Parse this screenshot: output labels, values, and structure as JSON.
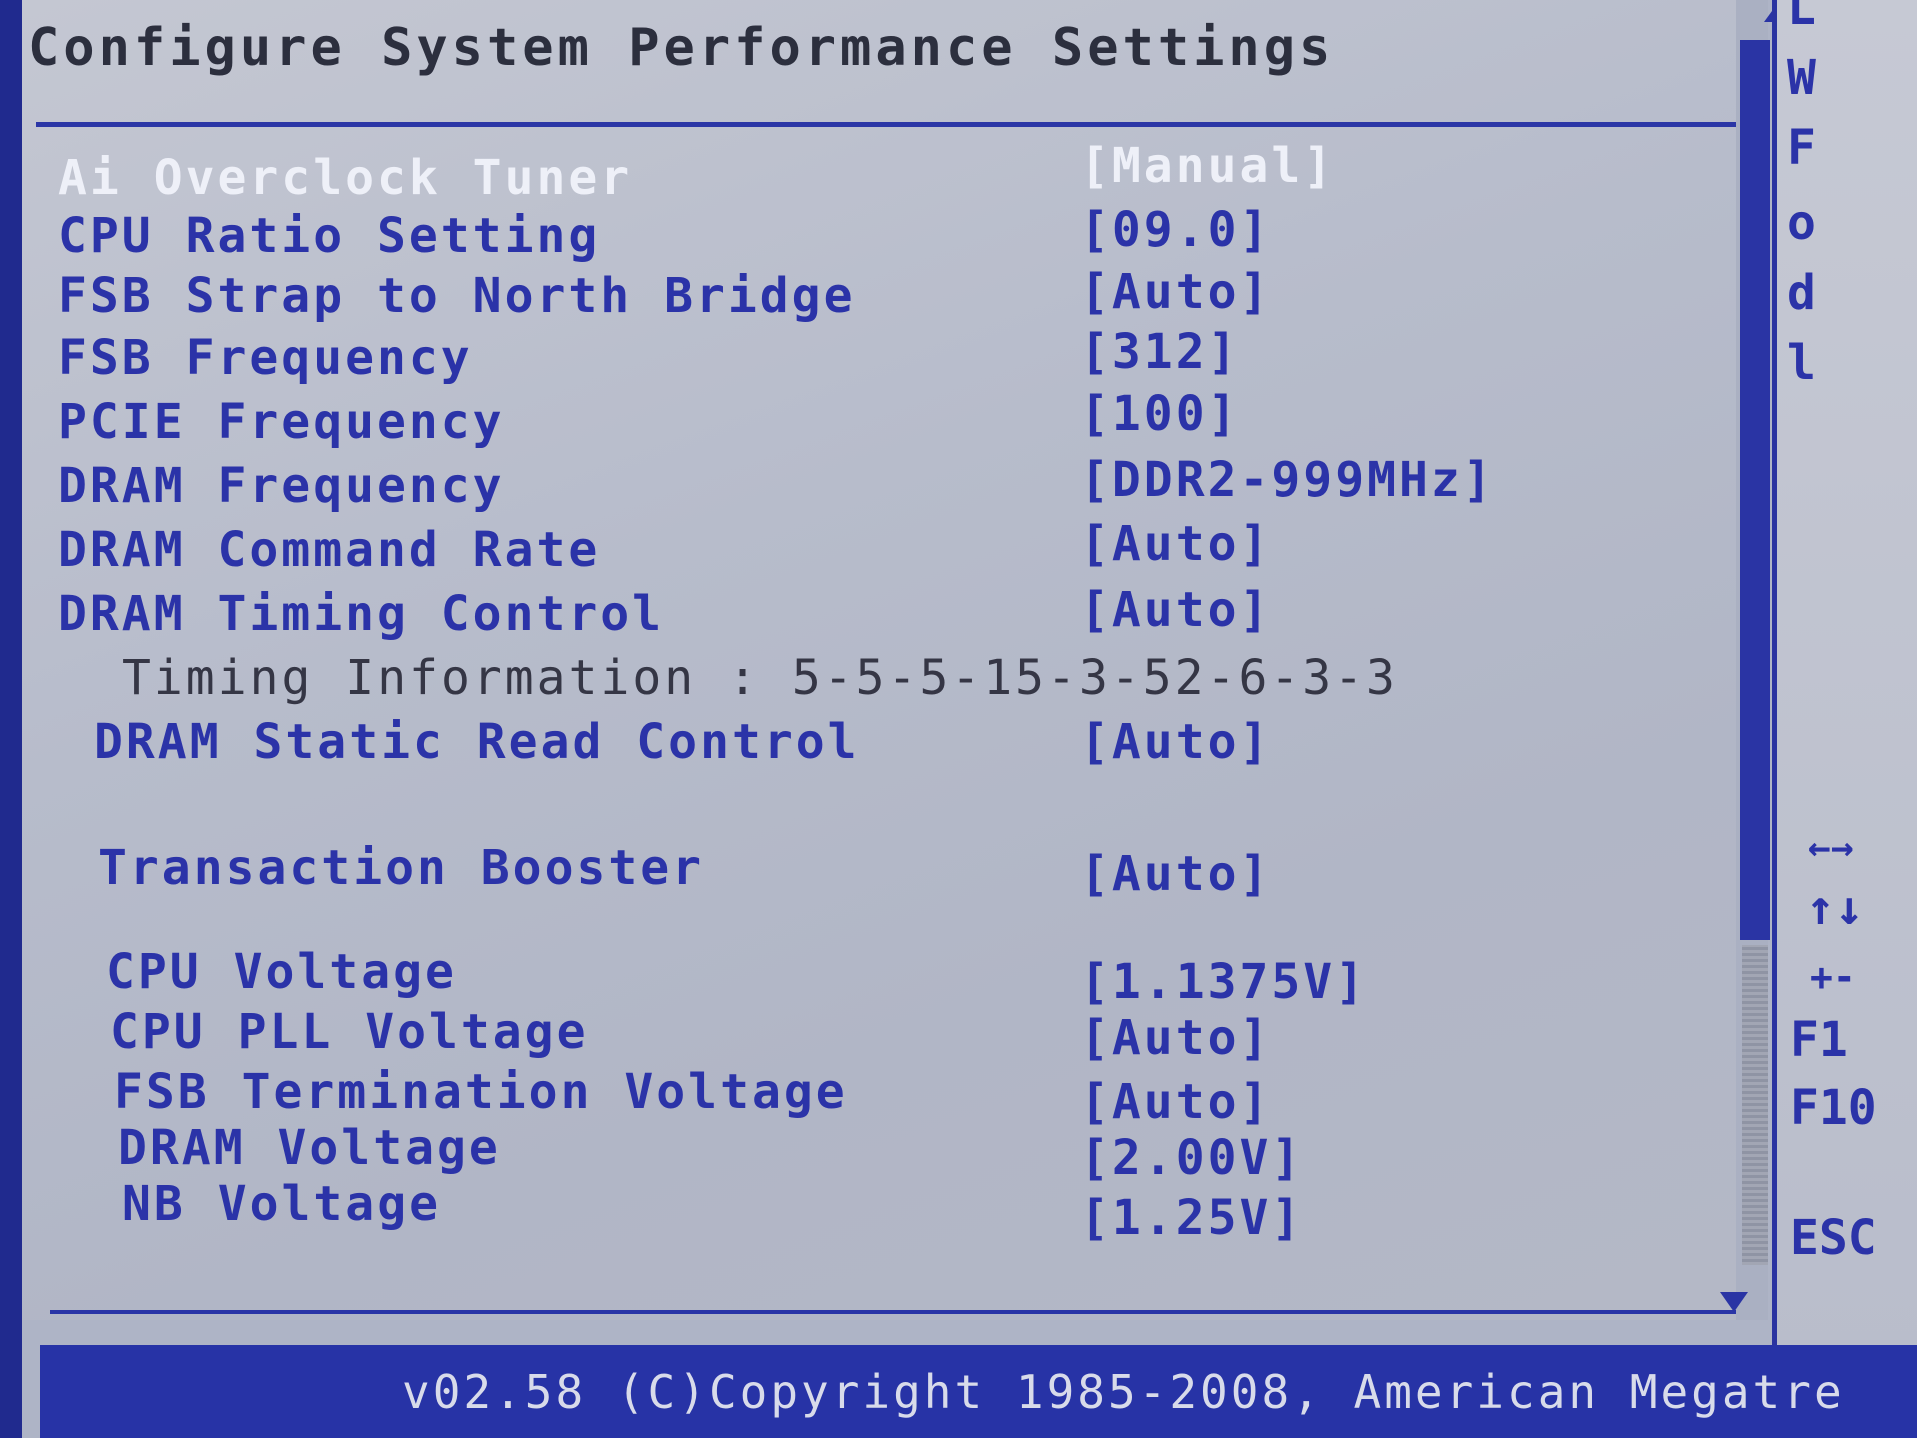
{
  "title": "Configure System Performance Settings",
  "settings": [
    {
      "label": "Ai Overclock Tuner",
      "value": "[Manual]"
    },
    {
      "label": "CPU Ratio Setting",
      "value": "[09.0]"
    },
    {
      "label": "FSB Strap to North Bridge",
      "value": "[Auto]"
    },
    {
      "label": "FSB Frequency",
      "value": "[312]"
    },
    {
      "label": "PCIE Frequency",
      "value": "[100]"
    },
    {
      "label": "DRAM Frequency",
      "value": "[DDR2-999MHz]"
    },
    {
      "label": "DRAM Command Rate",
      "value": "[Auto]"
    },
    {
      "label": "DRAM Timing Control",
      "value": "[Auto]"
    },
    {
      "label": "Timing Information : 5-5-5-15-3-52-6-3-3"
    },
    {
      "label": "DRAM Static Read Control",
      "value": "[Auto]"
    },
    {
      "label": "Transaction Booster",
      "value": "[Auto]"
    },
    {
      "label": "CPU Voltage",
      "value": "[1.1375V]"
    },
    {
      "label": "CPU PLL Voltage",
      "value": "[Auto]"
    },
    {
      "label": "FSB Termination Voltage",
      "value": "[Auto]"
    },
    {
      "label": "DRAM Voltage",
      "value": "[2.00V]"
    },
    {
      "label": "NB Voltage",
      "value": "[1.25V]"
    }
  ],
  "help": {
    "lines": [
      "L",
      "W",
      "F",
      "o",
      "d",
      "l"
    ]
  },
  "keys": {
    "select_screen": "←→",
    "select_item": "↑↓",
    "change_field": "+-",
    "f1": "F1",
    "f10": "F10",
    "esc": "ESC"
  },
  "footer": {
    "copyright": "v02.58 (C)Copyright 1985-2008, American Megatre"
  },
  "colors": {
    "background": "#aeb4c6",
    "accent_blue": "#2b33a8",
    "selected_text": "#eef0f8",
    "footer_bar": "#2733a6"
  }
}
